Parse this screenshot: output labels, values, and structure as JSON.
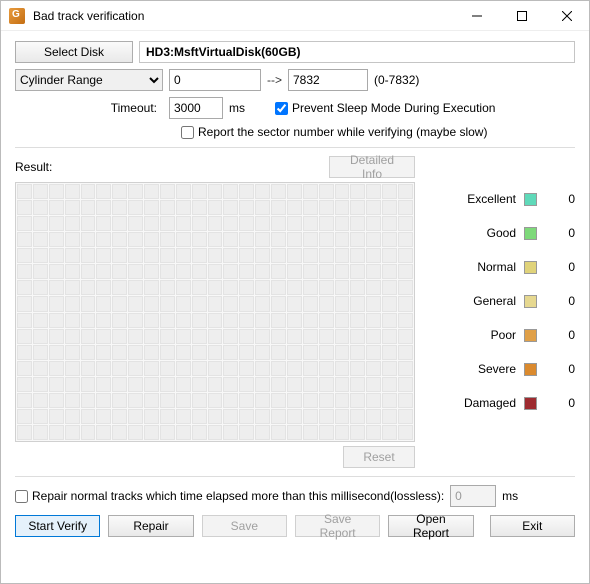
{
  "window": {
    "title": "Bad track verification"
  },
  "disk": {
    "select_button": "Select Disk",
    "name": "HD3:MsftVirtualDisk(60GB)"
  },
  "range": {
    "mode_label": "Cylinder Range",
    "start": "0",
    "end": "7832",
    "hint": "(0-7832)"
  },
  "timeout": {
    "label": "Timeout:",
    "value": "3000",
    "unit": "ms"
  },
  "checks": {
    "prevent_sleep": {
      "label": "Prevent Sleep Mode During Execution",
      "checked": true
    },
    "report_sector": {
      "label": "Report the sector number while verifying (maybe slow)",
      "checked": false
    }
  },
  "result": {
    "label": "Result:",
    "detailed_btn": "Detailed Info",
    "reset_btn": "Reset",
    "legend": [
      {
        "label": "Excellent",
        "color": "#5fd9b9",
        "value": 0
      },
      {
        "label": "Good",
        "color": "#7ed97a",
        "value": 0
      },
      {
        "label": "Normal",
        "color": "#e0d37a",
        "value": 0
      },
      {
        "label": "General",
        "color": "#e6d890",
        "value": 0
      },
      {
        "label": "Poor",
        "color": "#e0a048",
        "value": 0
      },
      {
        "label": "Severe",
        "color": "#db8a2e",
        "value": 0
      },
      {
        "label": "Damaged",
        "color": "#9e2b30",
        "value": 0
      }
    ]
  },
  "repair": {
    "label_pre": "Repair normal tracks which time elapsed more than this millisecond(lossless):",
    "value": "0",
    "unit": "ms",
    "checked": false
  },
  "buttons": {
    "start": "Start Verify",
    "repair": "Repair",
    "save": "Save",
    "save_report": "Save Report",
    "open_report": "Open Report",
    "exit": "Exit"
  }
}
